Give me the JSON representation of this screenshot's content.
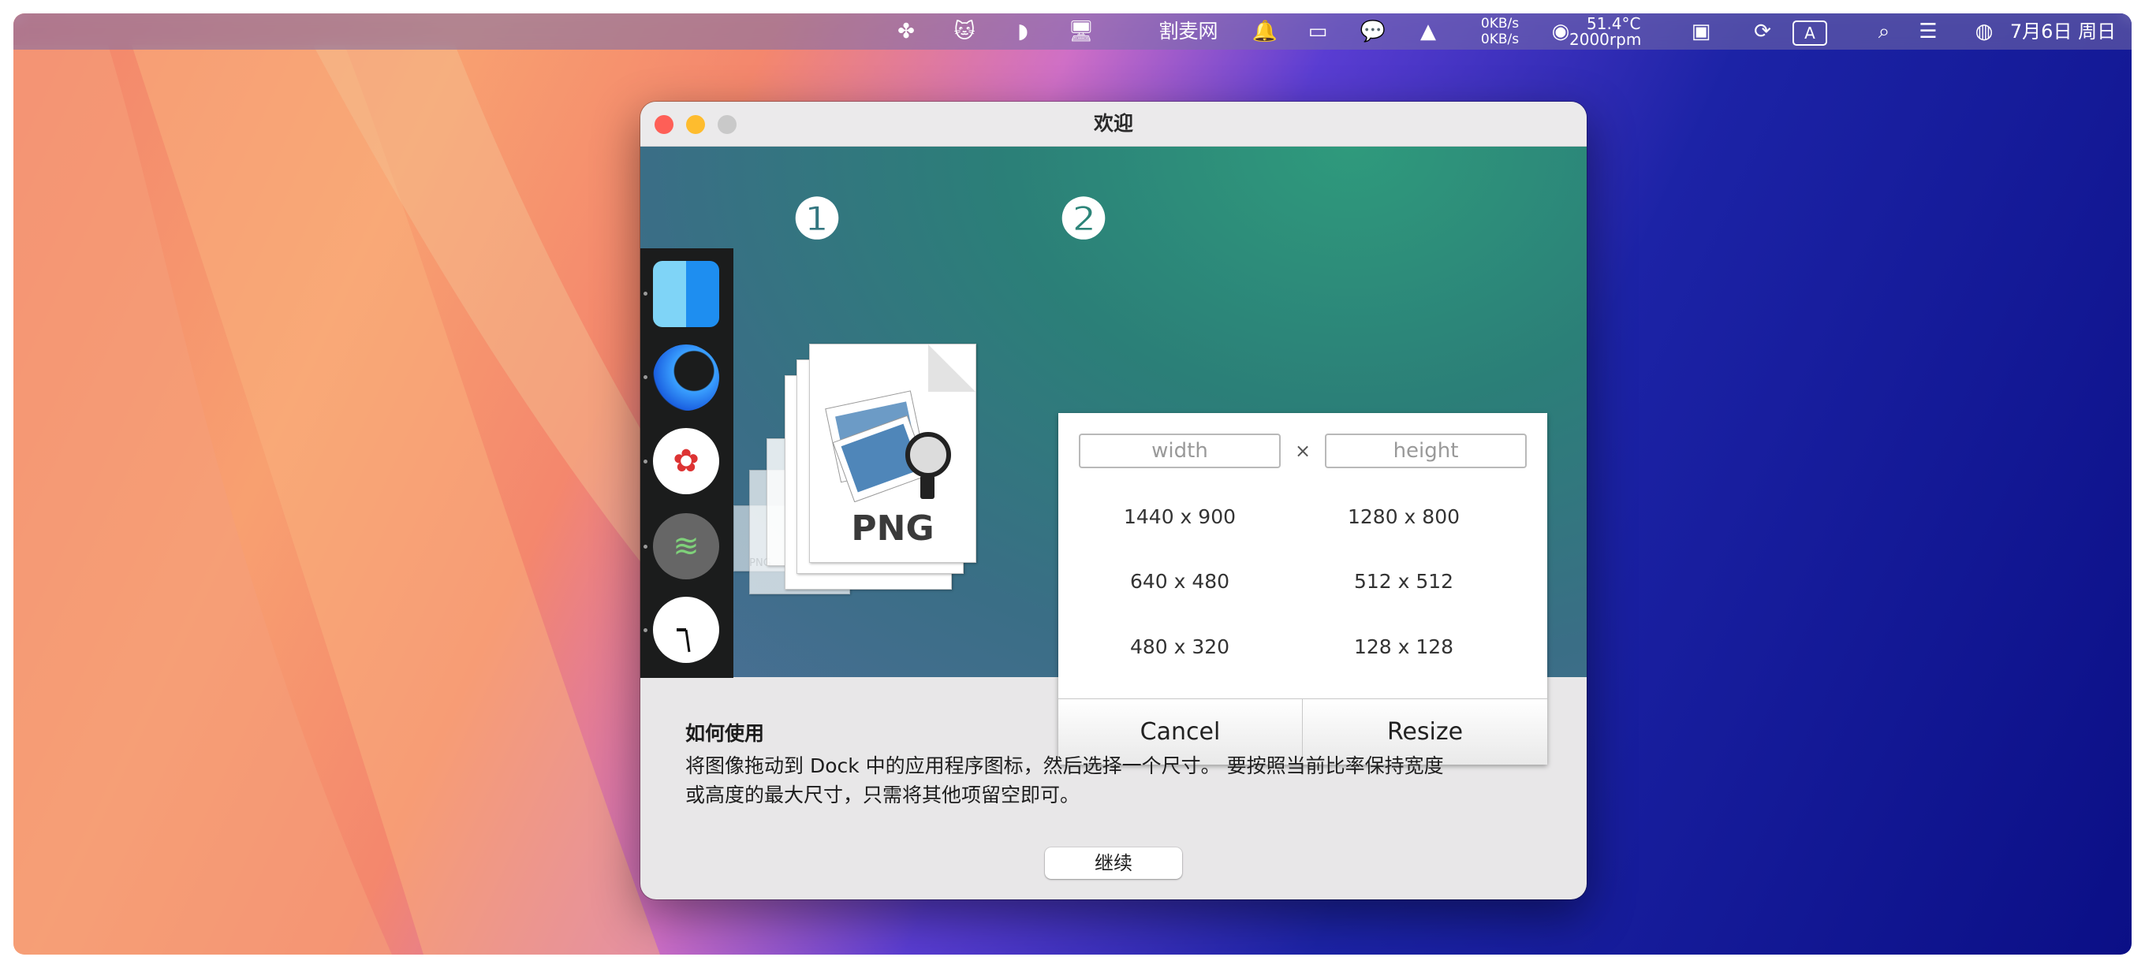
{
  "menubar": {
    "app_name": "割麦网",
    "net_up": "0KB/s",
    "net_down": "0KB/s",
    "cpu_temp": "51.4°C",
    "fan_speed": "2000rpm",
    "input_method": "A",
    "datetime": "7月6日 周日"
  },
  "window": {
    "title": "欢迎",
    "step1": "❶",
    "step2": "❷",
    "png_label": "PNG",
    "png_small": "PNG",
    "width_placeholder": "width",
    "height_placeholder": "height",
    "times": "×",
    "presets": [
      "1440 x 900",
      "1280 x 800",
      "640 x 480",
      "512 x 512",
      "480 x 320",
      "128 x 128"
    ],
    "cancel_label": "Cancel",
    "resize_label": "Resize",
    "howto_title": "如何使用",
    "howto_text_1": "将图像拖动到 Dock 中的应用程序图标，然后选择一个尺寸。 要按照当前比率保持宽度",
    "howto_text_2": "或高度的最大尺寸，只需将其他项留空即可。",
    "continue_label": "继续"
  },
  "colors": {
    "close": "#fe5f57",
    "minimize": "#febc2e",
    "zoom": "#c9c9c9",
    "badge_text": "#2a7d6f"
  }
}
